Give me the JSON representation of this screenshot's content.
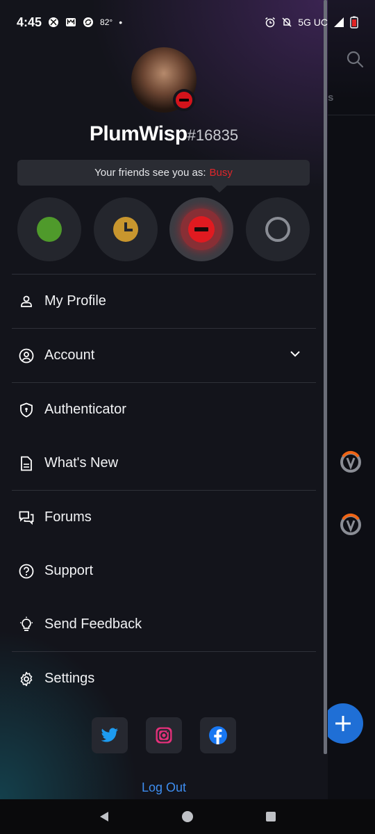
{
  "status_bar": {
    "time": "4:45",
    "temperature": "82°",
    "network": "5G UC",
    "icons": [
      "xbox-icon",
      "m-app-icon",
      "sync-icon",
      "dot-icon",
      "alarm-icon",
      "bell-muted-icon",
      "signal-icon",
      "battery-icon"
    ]
  },
  "background_app": {
    "tab_fragment": "s"
  },
  "profile": {
    "name": "PlumWisp",
    "tag": "#16835",
    "status_prefix": "Your friends see you as:",
    "status_value": "Busy",
    "status_color": "#e0262a"
  },
  "status_options": [
    {
      "name": "online",
      "color": "#4f9a2b"
    },
    {
      "name": "away",
      "color": "#c8962e"
    },
    {
      "name": "busy",
      "color": "#e01a20",
      "selected": true
    },
    {
      "name": "offline",
      "color": "#8a8d95"
    }
  ],
  "menu": {
    "my_profile": "My Profile",
    "account": "Account",
    "authenticator": "Authenticator",
    "whats_new": "What's New",
    "forums": "Forums",
    "support": "Support",
    "send_feedback": "Send Feedback",
    "settings": "Settings"
  },
  "socials": [
    "twitter-icon",
    "instagram-icon",
    "facebook-icon"
  ],
  "logout_label": "Log Out",
  "colors": {
    "accent_blue": "#3e8ef1",
    "twitter": "#1d9bf0",
    "instagram": "#e4307a",
    "facebook": "#1877f2"
  }
}
